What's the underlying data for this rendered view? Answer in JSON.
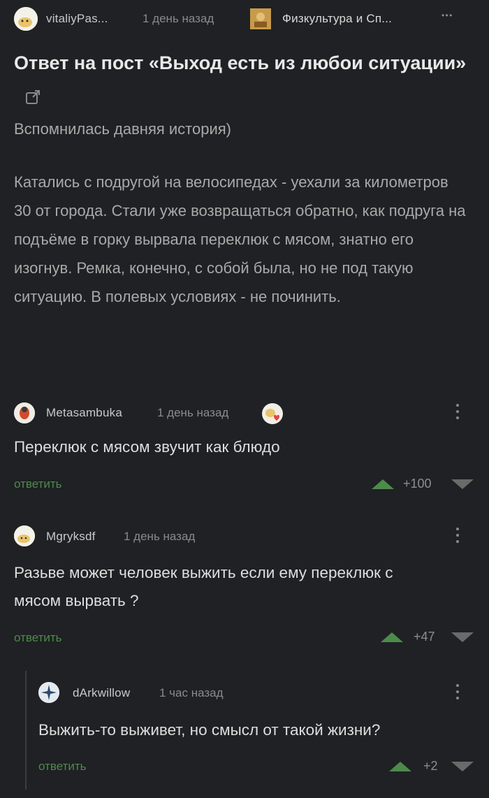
{
  "post": {
    "author": "vitaliyPas...",
    "time": "1 день назад",
    "community": "Физкультура и Сп...",
    "more": "• • •",
    "title": "Ответ на пост «Выход есть из любои ситуации»",
    "intro": "Вспомнилась давняя история)",
    "text": "Катались с подругой на велосипедах - уехали за километров 30 от города. Стали уже возвращаться обратно, как подруга на подъёме в горку вырвала переклюк с мясом, знатно его изогнув. Ремка, конечно, с собой была, но не под такую ситуацию. В полевых условиях - не починить."
  },
  "comments": [
    {
      "author": "Metasambuka",
      "time": "1 день назад",
      "text": "Переклюк с мясом звучит как блюдо",
      "reply": "ответить",
      "score": "+100"
    },
    {
      "author": "Mgryksdf",
      "time": "1 день назад",
      "text": "Разьве может человек выжить если ему переклюк с мясом вырвать ?",
      "reply": "ответить",
      "score": "+47"
    },
    {
      "author": "dArkwillow",
      "time": "1 час назад",
      "text": "Выжить-то выживет, но смысл от такой жизни?",
      "reply": "ответить",
      "score": "+2"
    }
  ],
  "colors": {
    "background": "#1f2124",
    "accent_green": "#4d8b4a",
    "text_primary": "#dedede",
    "text_secondary": "#a9a9a9"
  }
}
